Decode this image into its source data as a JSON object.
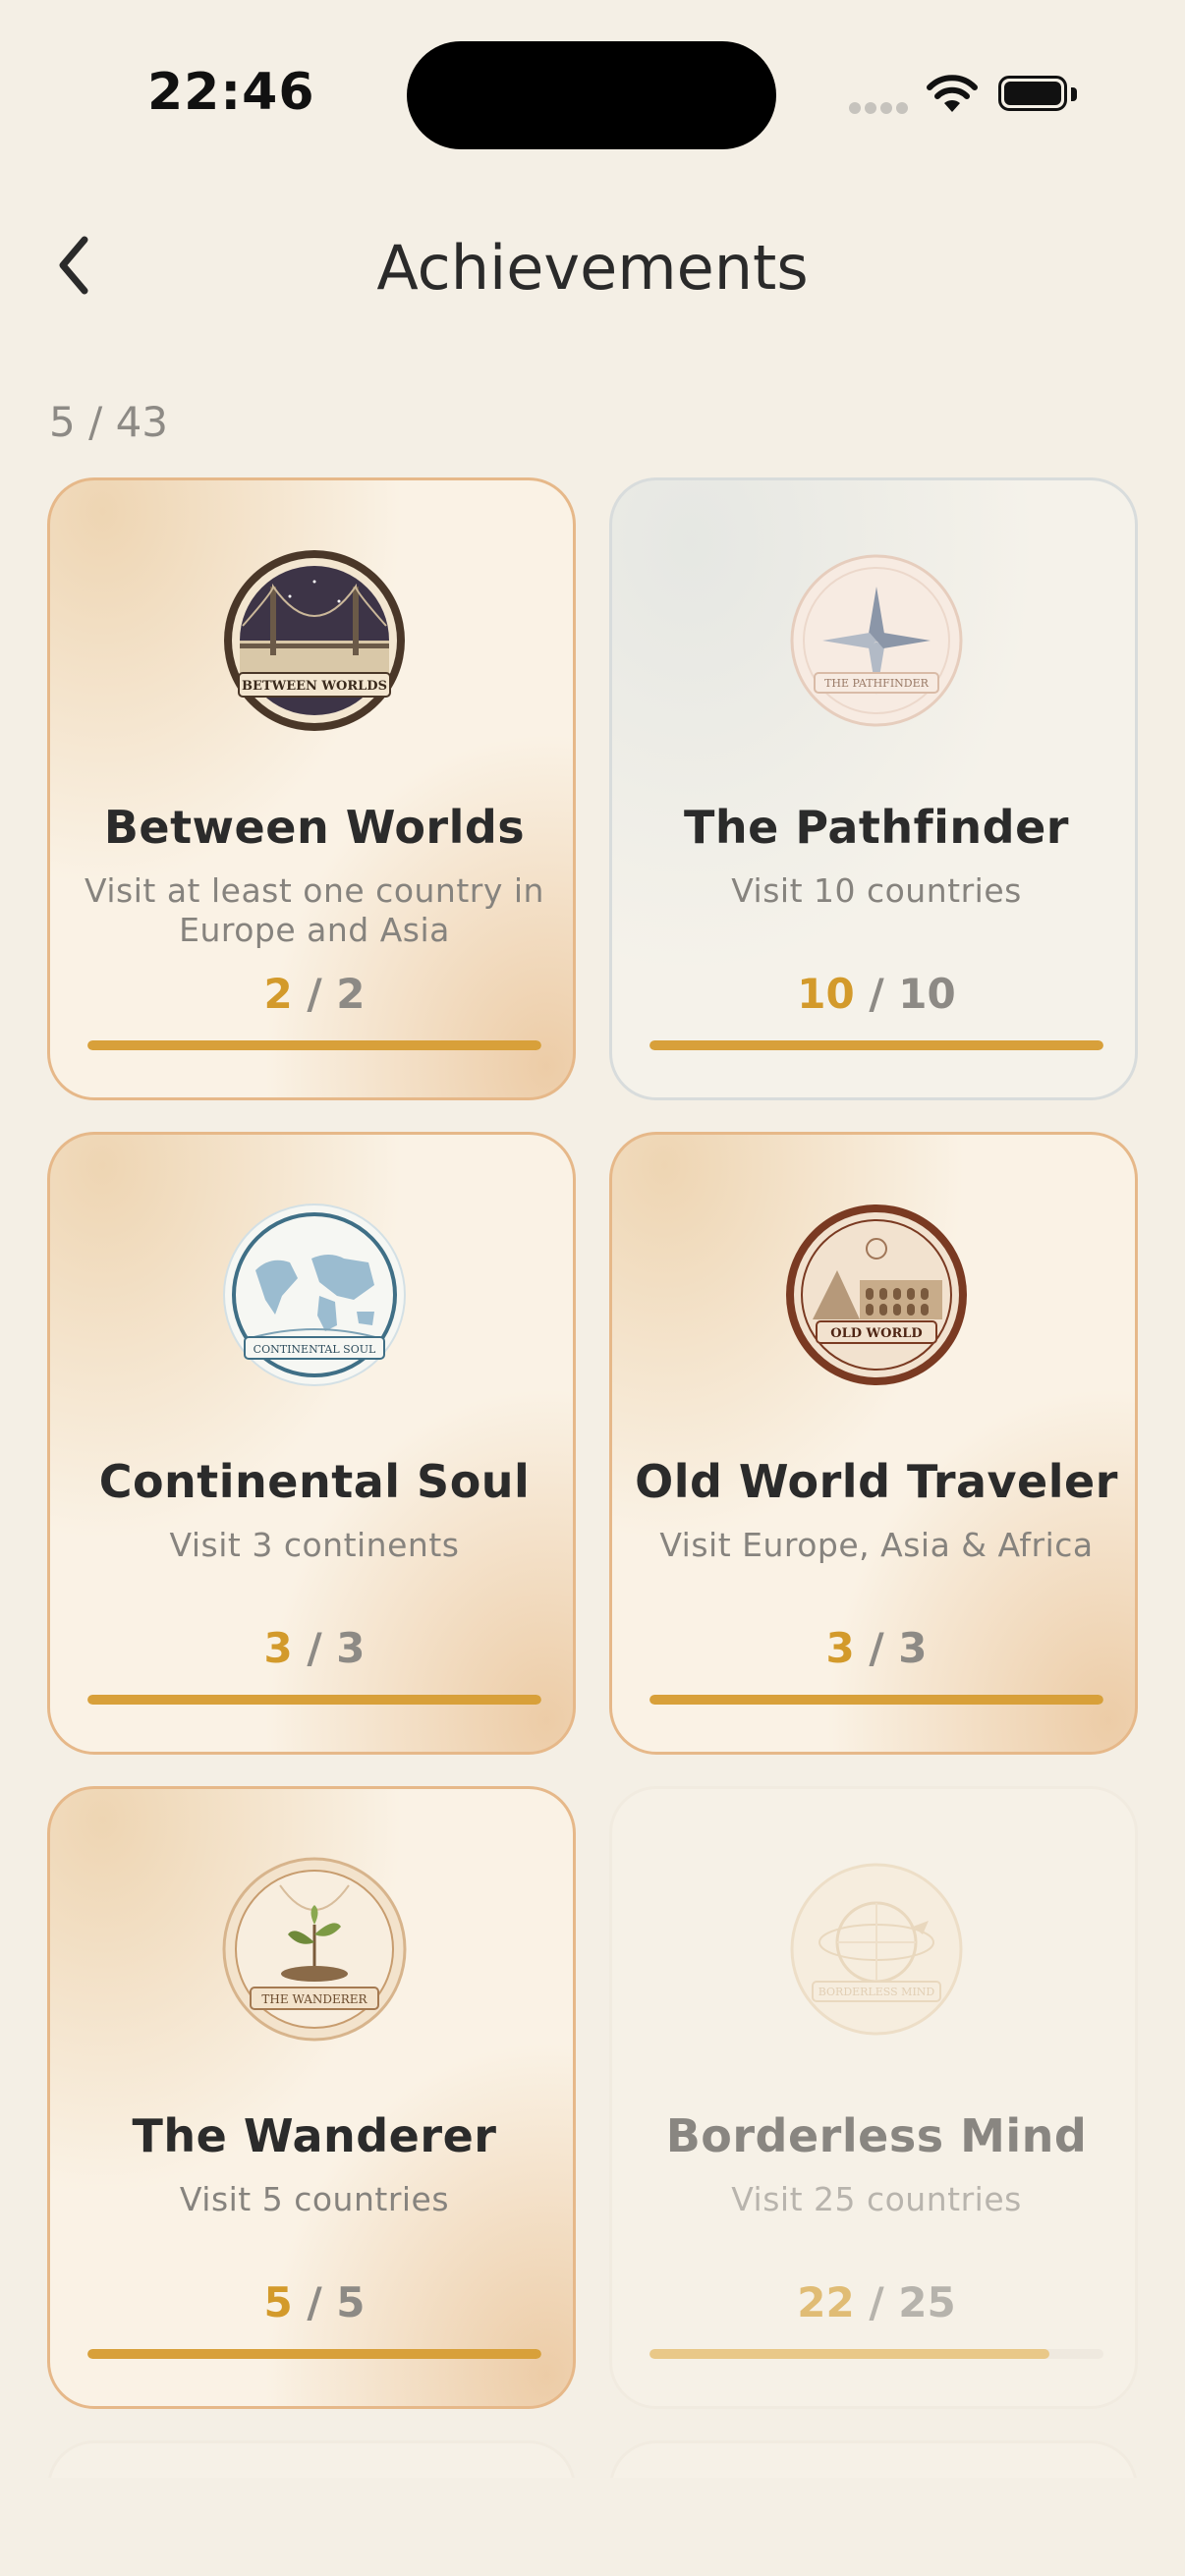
{
  "status_bar": {
    "time": "22:46"
  },
  "header": {
    "title": "Achievements",
    "back_icon": "chevron-left-icon"
  },
  "summary": {
    "count": "5 / 43"
  },
  "achievements": [
    {
      "title": "Between Worlds",
      "description": "Visit at least one country in Europe and Asia",
      "current": "2",
      "separator": " / ",
      "total": "2",
      "progress": 1.0,
      "state": "earned",
      "badge_icon": "bridge-badge-icon",
      "badge_text": "BETWEEN WORLDS"
    },
    {
      "title": "The Pathfinder",
      "description": "Visit 10 countries",
      "current": "10",
      "separator": " / ",
      "total": "10",
      "progress": 1.0,
      "state": "earned-silver",
      "badge_icon": "compass-badge-icon",
      "badge_text": "THE PATHFINDER"
    },
    {
      "title": "Continental Soul",
      "description": "Visit 3 continents",
      "current": "3",
      "separator": " / ",
      "total": "3",
      "progress": 1.0,
      "state": "earned",
      "badge_icon": "world-map-badge-icon",
      "badge_text": "CONTINENTAL SOUL"
    },
    {
      "title": "Old World Traveler",
      "description": "Visit Europe, Asia & Africa",
      "current": "3",
      "separator": " / ",
      "total": "3",
      "progress": 1.0,
      "state": "earned",
      "badge_icon": "colosseum-badge-icon",
      "badge_text": "OLD WORLD"
    },
    {
      "title": "The Wanderer",
      "description": "Visit 5 countries",
      "current": "5",
      "separator": " / ",
      "total": "5",
      "progress": 1.0,
      "state": "earned",
      "badge_icon": "sprout-badge-icon",
      "badge_text": "THE WANDERER"
    },
    {
      "title": "Borderless Mind",
      "description": "Visit 25 countries",
      "current": "22",
      "separator": " / ",
      "total": "25",
      "progress": 0.88,
      "state": "locked",
      "badge_icon": "globe-plane-badge-icon",
      "badge_text": "BORDERLESS MIND"
    }
  ],
  "colors": {
    "background": "#f4efe5",
    "accent": "#d39a2b",
    "progress_fill": "#d8a03a",
    "earned_border": "#e6b889"
  }
}
